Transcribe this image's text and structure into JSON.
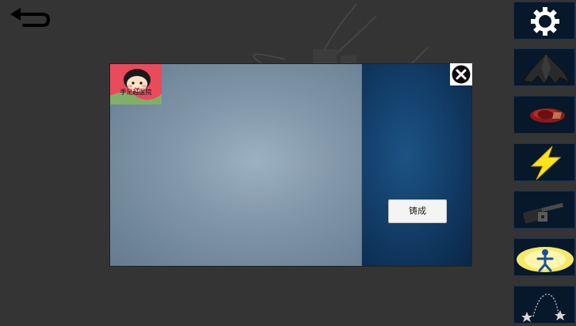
{
  "dialog": {
    "item": {
      "label": "手足越医院",
      "icon": "girl-portrait-icon"
    },
    "cast_button_label": "铸成",
    "close_icon": "close-icon"
  },
  "sidebar": {
    "slots": [
      {
        "name": "settings",
        "icon": "gear-icon"
      },
      {
        "name": "cloak",
        "icon": "cloak-icon"
      },
      {
        "name": "meat",
        "icon": "meat-icon"
      },
      {
        "name": "lightning",
        "icon": "lightning-icon"
      },
      {
        "name": "hammer",
        "icon": "hammer-icon"
      },
      {
        "name": "glowing-figure",
        "icon": "glowing-figure-icon"
      },
      {
        "name": "star-chain",
        "icon": "star-chain-icon"
      }
    ]
  },
  "colors": {
    "background": "#343434",
    "dialog_blue": "#133f6b",
    "panel_grey": "#8297a9",
    "item_red": "#e63a4e",
    "lightning_yellow": "#ffe41a"
  }
}
